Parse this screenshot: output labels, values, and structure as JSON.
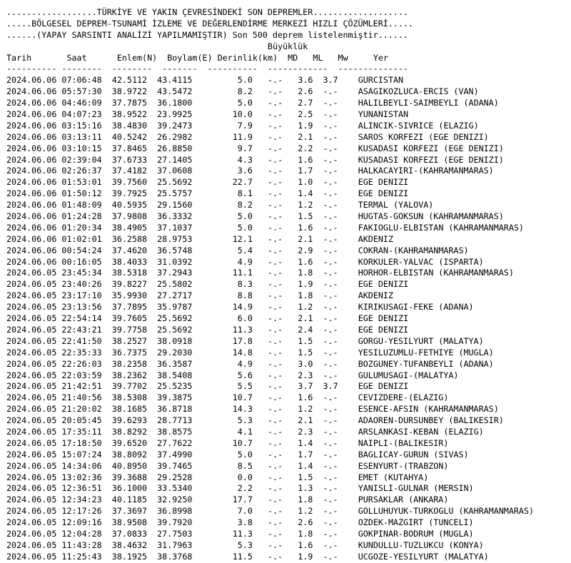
{
  "banner": [
    "..................TÜRKİYE VE YAKIN ÇEVRESİNDEKİ SON DEPREMLER...................",
    ".....BÖLGESEL DEPREM-TSUNAMİ İZLEME VE DEĞERLENDİRME MERKEZİ HIZLI ÇÖZÜMLERİ.....",
    "......(YAPAY SARSINTI ANALİZİ YAPILMAMIŞTIR) Son 500 deprem listelenmiştir......"
  ],
  "magnitude_group": "Büyüklük",
  "columns": {
    "date": "Tarih",
    "time": "Saat",
    "lat": "Enlem(N)",
    "lon": "Boylam(E)",
    "depth": "Derinlik(km)",
    "md": "MD",
    "ml": "ML",
    "mw": "Mw",
    "place": "Yer"
  },
  "separator": "---------- --------  --------  -------  ----------  ------------  --------------",
  "rows": [
    {
      "date": "2024.06.06",
      "time": "07:06:48",
      "lat": "42.5112",
      "lon": "43.4115",
      "depth": "5.0",
      "md": "-.-",
      "ml": "3.6",
      "mw": "3.7",
      "place": "GURCISTAN"
    },
    {
      "date": "2024.06.06",
      "time": "05:57:30",
      "lat": "38.9722",
      "lon": "43.5472",
      "depth": "8.2",
      "md": "-.-",
      "ml": "2.6",
      "mw": "-.-",
      "place": "ASAGIKOZLUCA-ERCIS (VAN)"
    },
    {
      "date": "2024.06.06",
      "time": "04:46:09",
      "lat": "37.7875",
      "lon": "36.1800",
      "depth": "5.0",
      "md": "-.-",
      "ml": "2.7",
      "mw": "-.-",
      "place": "HALILBEYLI-SAIMBEYLI (ADANA)"
    },
    {
      "date": "2024.06.06",
      "time": "04:07:23",
      "lat": "38.9522",
      "lon": "23.9925",
      "depth": "10.0",
      "md": "-.-",
      "ml": "2.5",
      "mw": "-.-",
      "place": "YUNANISTAN"
    },
    {
      "date": "2024.06.06",
      "time": "03:15:16",
      "lat": "38.4830",
      "lon": "39.2473",
      "depth": "7.9",
      "md": "-.-",
      "ml": "1.9",
      "mw": "-.-",
      "place": "ALINCIK-SIVRICE (ELAZIG)"
    },
    {
      "date": "2024.06.06",
      "time": "03:13:11",
      "lat": "40.5242",
      "lon": "26.2982",
      "depth": "11.9",
      "md": "-.-",
      "ml": "2.1",
      "mw": "-.-",
      "place": "SAROS KORFEZI (EGE DENIZI)"
    },
    {
      "date": "2024.06.06",
      "time": "03:10:15",
      "lat": "37.8465",
      "lon": "26.8850",
      "depth": "9.7",
      "md": "-.-",
      "ml": "2.2",
      "mw": "-.-",
      "place": "KUSADASI KORFEZI (EGE DENIZI)"
    },
    {
      "date": "2024.06.06",
      "time": "02:39:04",
      "lat": "37.6733",
      "lon": "27.1405",
      "depth": "4.3",
      "md": "-.-",
      "ml": "1.6",
      "mw": "-.-",
      "place": "KUSADASI KORFEZI (EGE DENIZI)"
    },
    {
      "date": "2024.06.06",
      "time": "02:26:37",
      "lat": "37.4182",
      "lon": "37.0608",
      "depth": "3.6",
      "md": "-.-",
      "ml": "1.7",
      "mw": "-.-",
      "place": "HALKACAYIRI-(KAHRAMANMARAS)"
    },
    {
      "date": "2024.06.06",
      "time": "01:53:01",
      "lat": "39.7560",
      "lon": "25.5692",
      "depth": "22.7",
      "md": "-.-",
      "ml": "1.0",
      "mw": "-.-",
      "place": "EGE DENIZI"
    },
    {
      "date": "2024.06.06",
      "time": "01:50:12",
      "lat": "39.7925",
      "lon": "25.5757",
      "depth": "8.1",
      "md": "-.-",
      "ml": "1.4",
      "mw": "-.-",
      "place": "EGE DENIZI"
    },
    {
      "date": "2024.06.06",
      "time": "01:48:09",
      "lat": "40.5935",
      "lon": "29.1560",
      "depth": "8.2",
      "md": "-.-",
      "ml": "1.2",
      "mw": "-.-",
      "place": "TERMAL (YALOVA)"
    },
    {
      "date": "2024.06.06",
      "time": "01:24:28",
      "lat": "37.9808",
      "lon": "36.3332",
      "depth": "5.0",
      "md": "-.-",
      "ml": "1.5",
      "mw": "-.-",
      "place": "HUGTAS-GOKSUN (KAHRAMANMARAS)"
    },
    {
      "date": "2024.06.06",
      "time": "01:20:34",
      "lat": "38.4905",
      "lon": "37.1037",
      "depth": "5.0",
      "md": "-.-",
      "ml": "1.6",
      "mw": "-.-",
      "place": "FAKIOGLU-ELBISTAN (KAHRAMANMARAS)"
    },
    {
      "date": "2024.06.06",
      "time": "01:02:01",
      "lat": "36.2588",
      "lon": "28.9753",
      "depth": "12.1",
      "md": "-.-",
      "ml": "2.1",
      "mw": "-.-",
      "place": "AKDENIZ"
    },
    {
      "date": "2024.06.06",
      "time": "00:54:24",
      "lat": "37.4620",
      "lon": "36.5748",
      "depth": "5.4",
      "md": "-.-",
      "ml": "2.9",
      "mw": "-.-",
      "place": "COKRAN-(KAHRAMANMARAS)"
    },
    {
      "date": "2024.06.06",
      "time": "00:16:05",
      "lat": "38.4033",
      "lon": "31.0392",
      "depth": "4.9",
      "md": "-.-",
      "ml": "1.6",
      "mw": "-.-",
      "place": "KORKULER-YALVAC (ISPARTA)"
    },
    {
      "date": "2024.06.05",
      "time": "23:45:34",
      "lat": "38.5318",
      "lon": "37.2943",
      "depth": "11.1",
      "md": "-.-",
      "ml": "1.8",
      "mw": "-.-",
      "place": "HORHOR-ELBISTAN (KAHRAMANMARAS)"
    },
    {
      "date": "2024.06.05",
      "time": "23:40:26",
      "lat": "39.8227",
      "lon": "25.5802",
      "depth": "8.3",
      "md": "-.-",
      "ml": "1.9",
      "mw": "-.-",
      "place": "EGE DENIZI"
    },
    {
      "date": "2024.06.05",
      "time": "23:17:10",
      "lat": "35.9930",
      "lon": "27.2717",
      "depth": "8.8",
      "md": "-.-",
      "ml": "1.8",
      "mw": "-.-",
      "place": "AKDENIZ"
    },
    {
      "date": "2024.06.05",
      "time": "23:13:56",
      "lat": "37.7895",
      "lon": "35.9787",
      "depth": "14.9",
      "md": "-.-",
      "ml": "1.2",
      "mw": "-.-",
      "place": "KIRIKUSAGI-FEKE (ADANA)"
    },
    {
      "date": "2024.06.05",
      "time": "22:54:14",
      "lat": "39.7605",
      "lon": "25.5692",
      "depth": "6.0",
      "md": "-.-",
      "ml": "2.1",
      "mw": "-.-",
      "place": "EGE DENIZI"
    },
    {
      "date": "2024.06.05",
      "time": "22:43:21",
      "lat": "39.7758",
      "lon": "25.5692",
      "depth": "11.3",
      "md": "-.-",
      "ml": "2.4",
      "mw": "-.-",
      "place": "EGE DENIZI"
    },
    {
      "date": "2024.06.05",
      "time": "22:41:50",
      "lat": "38.2527",
      "lon": "38.0918",
      "depth": "17.8",
      "md": "-.-",
      "ml": "1.5",
      "mw": "-.-",
      "place": "GORGU-YESILYURT (MALATYA)"
    },
    {
      "date": "2024.06.05",
      "time": "22:35:33",
      "lat": "36.7375",
      "lon": "29.2030",
      "depth": "14.8",
      "md": "-.-",
      "ml": "1.5",
      "mw": "-.-",
      "place": "YESILUZUMLU-FETHIYE (MUGLA)"
    },
    {
      "date": "2024.06.05",
      "time": "22:26:03",
      "lat": "38.2358",
      "lon": "36.3587",
      "depth": "4.9",
      "md": "-.-",
      "ml": "3.0",
      "mw": "-.-",
      "place": "BOZGUNEY-TUFANBEYLI (ADANA)"
    },
    {
      "date": "2024.06.05",
      "time": "22:03:59",
      "lat": "38.2362",
      "lon": "38.5408",
      "depth": "5.6",
      "md": "-.-",
      "ml": "2.3",
      "mw": "-.-",
      "place": "GULUMUSAGI-(MALATYA)"
    },
    {
      "date": "2024.06.05",
      "time": "21:42:51",
      "lat": "39.7702",
      "lon": "25.5235",
      "depth": "5.5",
      "md": "-.-",
      "ml": "3.7",
      "mw": "3.7",
      "place": "EGE DENIZI"
    },
    {
      "date": "2024.06.05",
      "time": "21:40:56",
      "lat": "38.5308",
      "lon": "39.3875",
      "depth": "10.7",
      "md": "-.-",
      "ml": "1.6",
      "mw": "-.-",
      "place": "CEVIZDERE-(ELAZIG)"
    },
    {
      "date": "2024.06.05",
      "time": "21:20:02",
      "lat": "38.1685",
      "lon": "36.8718",
      "depth": "14.3",
      "md": "-.-",
      "ml": "1.2",
      "mw": "-.-",
      "place": "ESENCE-AFSIN (KAHRAMANMARAS)"
    },
    {
      "date": "2024.06.05",
      "time": "20:05:45",
      "lat": "39.6293",
      "lon": "28.7713",
      "depth": "5.3",
      "md": "-.-",
      "ml": "2.1",
      "mw": "-.-",
      "place": "ADAOREN-DURSUNBEY (BALIKESIR)"
    },
    {
      "date": "2024.06.05",
      "time": "17:35:11",
      "lat": "38.8292",
      "lon": "38.8575",
      "depth": "4.1",
      "md": "-.-",
      "ml": "2.3",
      "mw": "-.-",
      "place": "ARSLANKASI-KEBAN (ELAZIG)"
    },
    {
      "date": "2024.06.05",
      "time": "17:18:50",
      "lat": "39.6520",
      "lon": "27.7622",
      "depth": "10.7",
      "md": "-.-",
      "ml": "1.4",
      "mw": "-.-",
      "place": "NAIPLI-(BALIKESIR)"
    },
    {
      "date": "2024.06.05",
      "time": "15:07:24",
      "lat": "38.8092",
      "lon": "37.4990",
      "depth": "5.0",
      "md": "-.-",
      "ml": "1.7",
      "mw": "-.-",
      "place": "BAGLICAY-GURUN (SIVAS)"
    },
    {
      "date": "2024.06.05",
      "time": "14:34:06",
      "lat": "40.8950",
      "lon": "39.7465",
      "depth": "8.5",
      "md": "-.-",
      "ml": "1.4",
      "mw": "-.-",
      "place": "ESENYURT-(TRABZON)"
    },
    {
      "date": "2024.06.05",
      "time": "13:02:36",
      "lat": "39.3688",
      "lon": "29.2528",
      "depth": "0.0",
      "md": "-.-",
      "ml": "1.5",
      "mw": "-.-",
      "place": "EMET (KUTAHYA)"
    },
    {
      "date": "2024.06.05",
      "time": "12:36:51",
      "lat": "36.1000",
      "lon": "33.5340",
      "depth": "2.2",
      "md": "-.-",
      "ml": "1.3",
      "mw": "-.-",
      "place": "YANISLI-GULNAR (MERSIN)"
    },
    {
      "date": "2024.06.05",
      "time": "12:34:23",
      "lat": "40.1185",
      "lon": "32.9250",
      "depth": "17.7",
      "md": "-.-",
      "ml": "1.8",
      "mw": "-.-",
      "place": "PURSAKLAR (ANKARA)"
    },
    {
      "date": "2024.06.05",
      "time": "12:17:26",
      "lat": "37.3697",
      "lon": "36.8998",
      "depth": "7.0",
      "md": "-.-",
      "ml": "1.2",
      "mw": "-.-",
      "place": "GOLLUHUYUK-TURKOGLU (KAHRAMANMARAS)"
    },
    {
      "date": "2024.06.05",
      "time": "12:09:16",
      "lat": "38.9508",
      "lon": "39.7920",
      "depth": "3.8",
      "md": "-.-",
      "ml": "2.6",
      "mw": "-.-",
      "place": "OZDEK-MAZGIRT (TUNCELI)"
    },
    {
      "date": "2024.06.05",
      "time": "12:04:28",
      "lat": "37.0833",
      "lon": "27.7503",
      "depth": "11.3",
      "md": "-.-",
      "ml": "1.8",
      "mw": "-.-",
      "place": "GOKPINAR-BODRUM (MUGLA)"
    },
    {
      "date": "2024.06.05",
      "time": "11:43:28",
      "lat": "38.4632",
      "lon": "31.7963",
      "depth": "5.3",
      "md": "-.-",
      "ml": "1.6",
      "mw": "-.-",
      "place": "KUNDULLU-TUZLUKCU (KONYA)"
    },
    {
      "date": "2024.06.05",
      "time": "11:25:43",
      "lat": "38.1925",
      "lon": "38.3768",
      "depth": "11.5",
      "md": "-.-",
      "ml": "1.9",
      "mw": "-.-",
      "place": "UCGOZE-YESILYURT (MALATYA)"
    }
  ]
}
